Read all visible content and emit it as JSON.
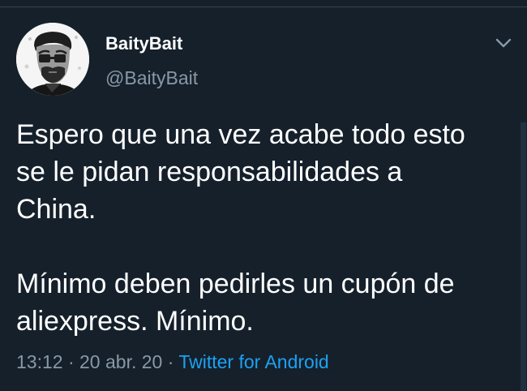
{
  "author": {
    "display_name": "BaityBait",
    "handle": "@BaityBait",
    "avatar_icon": "profile-photo-man-with-glasses"
  },
  "menu": {
    "caret_icon": "chevron-down-icon"
  },
  "tweet": {
    "paragraph_1": "Espero que una vez acabe todo esto\nse le pidan responsabilidades a\nChina.",
    "paragraph_2": "Mínimo deben pedirles un cupón de\naliexpress. Mínimo."
  },
  "meta": {
    "time": "13:12",
    "separator_1": " · ",
    "date": "20 abr. 20",
    "separator_2": " · ",
    "source": "Twitter for Android"
  },
  "colors": {
    "background": "#15202b",
    "text_primary": "#ffffff",
    "text_secondary": "#8899a6",
    "link": "#1da1f2",
    "divider": "#38444d"
  }
}
